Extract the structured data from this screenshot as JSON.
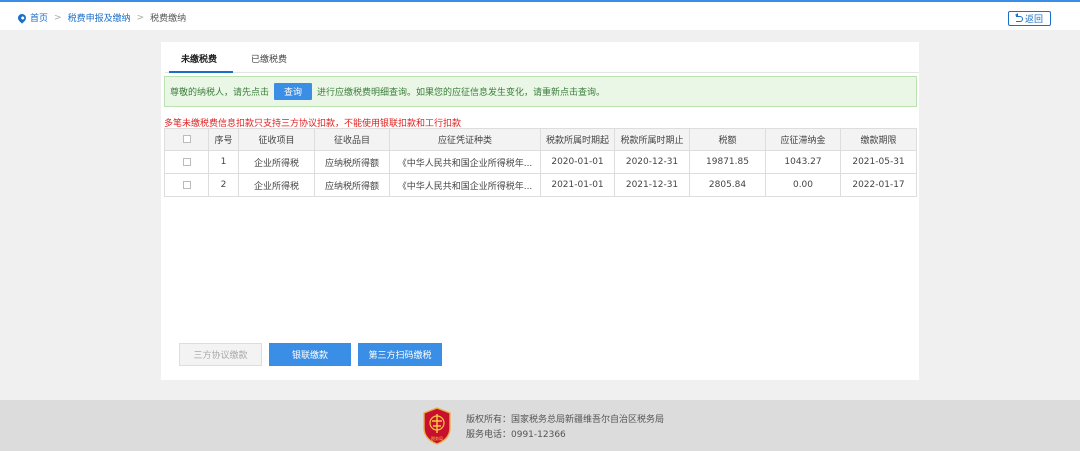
{
  "breadcrumb": {
    "home": "首页",
    "level2": "税费申报及缴纳",
    "current": "税费缴纳"
  },
  "back_label": "返回",
  "tabs": [
    {
      "label": "未缴税费",
      "active": true
    },
    {
      "label": "已缴税费",
      "active": false
    }
  ],
  "notice": {
    "before": "尊敬的纳税人，请先点击",
    "button": "查询",
    "after": "进行应缴税费明细查询。如果您的应征信息发生变化，请重新点击查询。"
  },
  "warning": "多笔未缴税费信息扣款只支持三方协议扣款，不能使用银联扣款和工行扣款",
  "table": {
    "headers": [
      "序号",
      "征收项目",
      "征收品目",
      "应征凭证种类",
      "税款所属时期起",
      "税款所属时期止",
      "税额",
      "应征滞纳金",
      "缴款期限"
    ],
    "rows": [
      [
        "1",
        "企业所得税",
        "应纳税所得额",
        "《中华人民共和国企业所得税年...",
        "2020-01-01",
        "2020-12-31",
        "19871.85",
        "1043.27",
        "2021-05-31"
      ],
      [
        "2",
        "企业所得税",
        "应纳税所得额",
        "《中华人民共和国企业所得税年...",
        "2021-01-01",
        "2021-12-31",
        "2805.84",
        "0.00",
        "2022-01-17"
      ]
    ]
  },
  "actions": {
    "three_party": "三方协议缴款",
    "unionpay": "银联缴款",
    "third_party_scan": "第三方扫码缴税"
  },
  "footer": {
    "copyright": "版权所有：国家税务总局新疆维吾尔自治区税务局",
    "phone": "服务电话：0991-12366",
    "logo_text": "税务局"
  },
  "colors": {
    "accent": "#3a8ee6",
    "warning": "#e02020",
    "notice_bg": "#eaf7e6"
  }
}
